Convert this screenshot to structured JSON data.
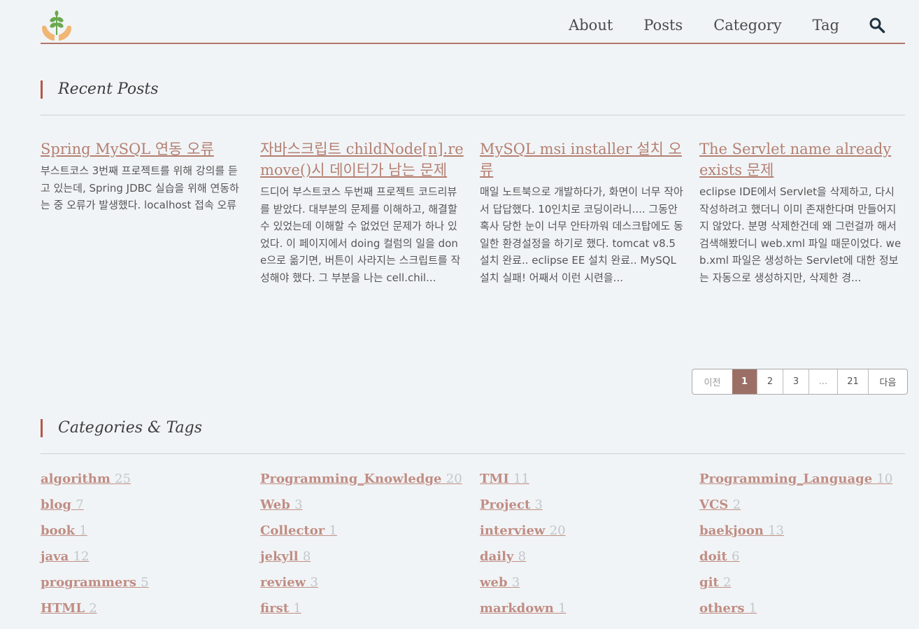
{
  "nav": {
    "items": [
      "About",
      "Posts",
      "Category",
      "Tag"
    ],
    "search_icon": "magnifier-icon"
  },
  "logo_icon": "sprout-in-hands-logo",
  "recent": {
    "title": "Recent Posts",
    "posts": [
      {
        "title": "Spring MySQL 연동 오류",
        "excerpt": "부스트코스 3번째 프로젝트를 위해 강의를 듣고 있는데, Spring JDBC 실습을 위해 연동하는 중 오류가 발생했다. localhost 접속 오류"
      },
      {
        "title": "자바스크립트 childNode[n].remove()시 데이터가 남는 문제",
        "excerpt": "드디어 부스트코스 두번째 프로젝트 코드리뷰를 받았다. 대부분의 문제를 이해하고, 해결할 수 있었는데 이해할 수 없었던 문제가 하나 있었다. 이 페이지에서 doing 컬럼의 일을 done으로 옮기면, 버튼이 사라지는 스크립트를 작성해야 했다. 그 부분을 나는 cell.chil..."
      },
      {
        "title": "MySQL msi installer 설치 오류",
        "excerpt": "매일 노트북으로 개발하다가, 화면이 너무 작아서 답답했다. 10인치로 코딩이라니.... 그동안 혹사 당한 눈이 너무 안타까워 데스크탑에도 동일한 환경설정을 하기로 했다. tomcat v8.5 설치 완료.. eclipse EE 설치 완료.. MySQL 설치 실패! 어째서 이런 시련을..."
      },
      {
        "title": "The Servlet name already exists 문제",
        "excerpt": "eclipse IDE에서 Servlet을 삭제하고, 다시 작성하려고 했더니 이미 존재한다며 만들어지지 않았다. 분명 삭제한건데 왜 그런걸까 해서 검색해봤더니 web.xml 파일 때문이었다. web.xml 파일은 생성하는 Servlet에 대한 정보는 자동으로 생성하지만, 삭제한 경..."
      }
    ]
  },
  "pagination": {
    "prev": "이전",
    "pages": [
      "1",
      "2",
      "3",
      "...",
      "21"
    ],
    "current": "1",
    "next": "다음"
  },
  "categories": {
    "title": "Categories & Tags",
    "columns": [
      [
        {
          "name": "algorithm",
          "count": "25"
        },
        {
          "name": "blog",
          "count": "7"
        },
        {
          "name": "book",
          "count": "1"
        },
        {
          "name": "java",
          "count": "12"
        },
        {
          "name": "programmers",
          "count": "5"
        },
        {
          "name": "HTML",
          "count": "2"
        }
      ],
      [
        {
          "name": "Programming_Knowledge",
          "count": "20"
        },
        {
          "name": "Web",
          "count": "3"
        },
        {
          "name": "Collector",
          "count": "1"
        },
        {
          "name": "jekyll",
          "count": "8"
        },
        {
          "name": "review",
          "count": "3"
        },
        {
          "name": "first",
          "count": "1"
        }
      ],
      [
        {
          "name": "TMI",
          "count": "11"
        },
        {
          "name": "Project",
          "count": "3"
        },
        {
          "name": "interview",
          "count": "20"
        },
        {
          "name": "daily",
          "count": "8"
        },
        {
          "name": "web",
          "count": "3"
        },
        {
          "name": "markdown",
          "count": "1"
        }
      ],
      [
        {
          "name": "Programming_Language",
          "count": "10"
        },
        {
          "name": "VCS",
          "count": "2"
        },
        {
          "name": "baekjoon",
          "count": "13"
        },
        {
          "name": "doit",
          "count": "6"
        },
        {
          "name": "git",
          "count": "2"
        },
        {
          "name": "others",
          "count": "1"
        }
      ]
    ]
  },
  "colors": {
    "accent": "#b5574a",
    "link": "#b47f72",
    "header_rule": "#b0776a",
    "active_page": "#9c6f66",
    "background": "#f1f4f6"
  }
}
